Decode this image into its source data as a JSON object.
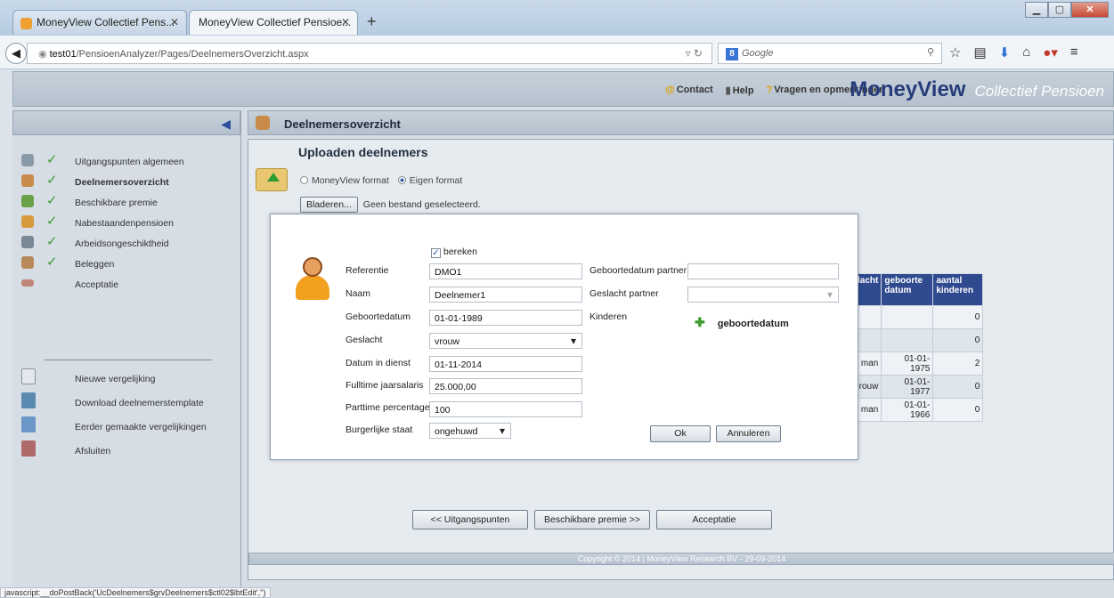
{
  "browser": {
    "tabs": [
      {
        "label": "MoneyView Collectief Pens...",
        "active": false
      },
      {
        "label": "MoneyView Collectief Pensioe...",
        "active": true
      }
    ],
    "url_host": "test01",
    "url_path": "/PensioenAnalyzer/Pages/DeelnemersOverzicht.aspx",
    "search_engine": "Google",
    "search_placeholder": "Google",
    "status_text": "javascript:__doPostBack('UcDeelnemers$grvDeelnemers$ctl02$lbtEdit','')"
  },
  "header": {
    "links": [
      {
        "label": "Contact",
        "icon": "contact-icon"
      },
      {
        "label": "Help",
        "icon": "help-book-icon"
      },
      {
        "label": "Vragen en opmerkingen",
        "icon": "question-icon"
      }
    ],
    "brand_main": "MoneyView",
    "brand_sub": "Collectief Pensioen"
  },
  "sidebar": {
    "items": [
      {
        "label": "Uitgangspunten algemeen",
        "icon": "person-icon",
        "color": "#8a9aa8",
        "checked": true
      },
      {
        "label": "Deelnemersoverzicht",
        "icon": "people-icon",
        "color": "#c98a4a",
        "checked": true,
        "current": true
      },
      {
        "label": "Beschikbare premie",
        "icon": "money-icon",
        "color": "#6aa048",
        "checked": true
      },
      {
        "label": "Nabestaandenpensioen",
        "icon": "family-icon",
        "color": "#d69a3c",
        "checked": true
      },
      {
        "label": "Arbeidsongeschiktheid",
        "icon": "wheelchair-icon",
        "color": "#7a8896",
        "checked": true
      },
      {
        "label": "Beleggen",
        "icon": "hand-coins-icon",
        "color": "#b88a5a",
        "checked": true
      },
      {
        "label": "Acceptatie",
        "icon": "handshake-icon",
        "color": "#c0867a",
        "checked": false
      }
    ],
    "tools": [
      {
        "label": "Nieuwe vergelijking",
        "icon": "new-document-icon",
        "color": "#e4e8ec"
      },
      {
        "label": "Download deelnemerstemplate",
        "icon": "download-template-icon",
        "color": "#5a8ab0"
      },
      {
        "label": "Eerder gemaakte vergelijkingen",
        "icon": "open-folder-icon",
        "color": "#6a96c8"
      },
      {
        "label": "Afsluiten",
        "icon": "exit-door-icon",
        "color": "#b06a6a"
      }
    ]
  },
  "main": {
    "title": "Deelnemersoverzicht",
    "upload_title": "Uploaden deelnemers",
    "format_options": [
      {
        "label": "MoneyView format",
        "selected": false
      },
      {
        "label": "Eigen format",
        "selected": true
      }
    ],
    "browse_label": "Bladeren...",
    "no_file_text": "Geen bestand geselecteerd.",
    "table": {
      "headers": [
        "lacht",
        "geboorte datum",
        "aantal kinderen"
      ],
      "rows": [
        [
          "",
          "",
          "0"
        ],
        [
          "",
          "",
          "0"
        ],
        [
          "man",
          "01-01-1975",
          "2"
        ],
        [
          "rouw",
          "01-01-1977",
          "0"
        ],
        [
          "man",
          "01-01-1966",
          "0"
        ]
      ]
    },
    "nav_buttons": [
      "<< Uitgangspunten",
      "Beschikbare premie >>",
      "Acceptatie"
    ],
    "footer": "Copyright © 2014 | MoneyView Research BV - 29-09-2014"
  },
  "modal": {
    "bereken_label": "bereken",
    "bereken_checked": true,
    "labels": {
      "referentie": "Referentie",
      "naam": "Naam",
      "geboortedatum": "Geboortedatum",
      "geslacht": "Geslacht",
      "datum_in_dienst": "Datum in dienst",
      "fulltime": "Fulltime jaarsalaris",
      "parttime": "Parttime percentage",
      "burgerlijke_staat": "Burgerlijke staat",
      "geboortedatum_partner": "Geboortedatum partner",
      "geslacht_partner": "Geslacht partner",
      "kinderen": "Kinderen"
    },
    "values": {
      "referentie": "DMO1",
      "naam": "Deelnemer1",
      "geboortedatum": "01-01-1989",
      "geslacht": "vrouw",
      "datum_in_dienst": "01-11-2014",
      "fulltime": "25.000,00",
      "parttime": "100",
      "burgerlijke_staat": "ongehuwd",
      "geboortedatum_partner": "",
      "geslacht_partner": ""
    },
    "kinderen_add_label": "geboortedatum",
    "ok_label": "Ok",
    "cancel_label": "Annuleren"
  }
}
